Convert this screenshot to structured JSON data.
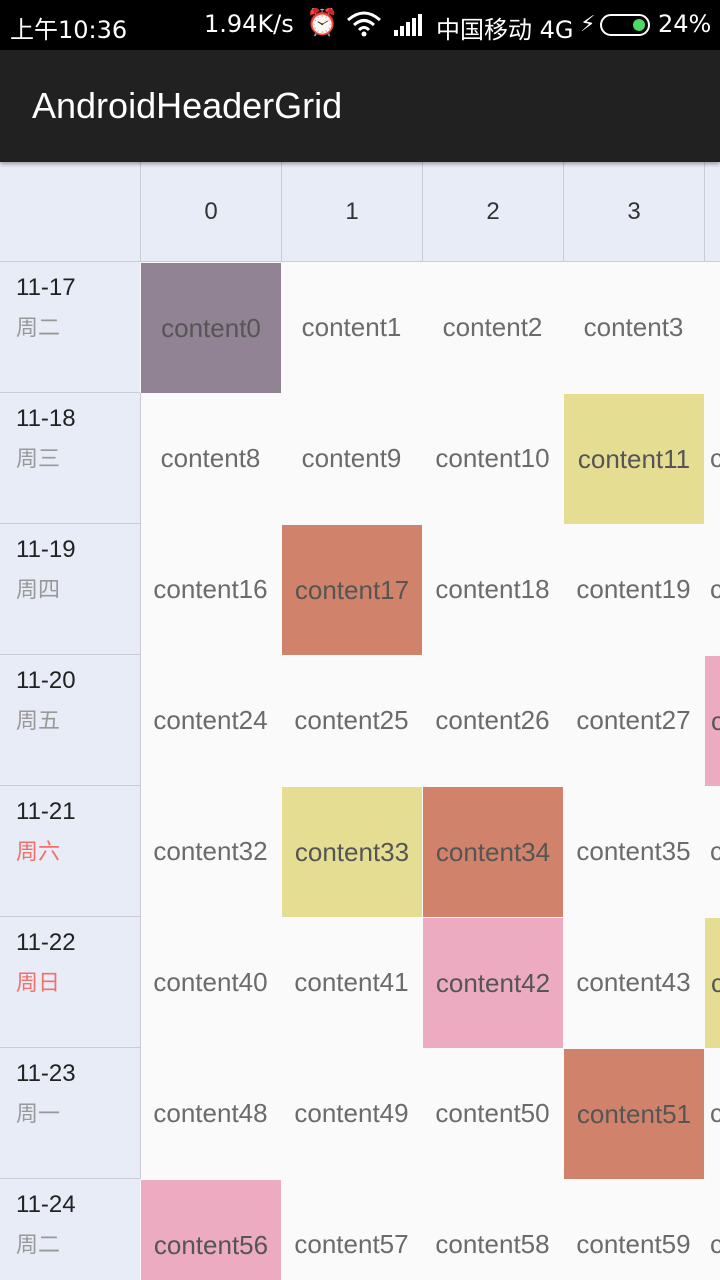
{
  "status_bar": {
    "time": "上午10:36",
    "net_speed": "1.94K/s",
    "alarm_icon": "alarm-clock-icon",
    "wifi_icon": "wifi-icon",
    "signal_icon": "signal-bars-icon",
    "carrier": "中国移动 4G",
    "charging_icon": "lightning-bolt-icon",
    "battery_icon": "battery-icon",
    "battery": "24%"
  },
  "app_bar": {
    "title": "AndroidHeaderGrid"
  },
  "grid": {
    "columns": [
      "0",
      "1",
      "2",
      "3",
      ""
    ],
    "rows": [
      {
        "date": "11-17",
        "weekday": "周二",
        "weekend": false,
        "cells": [
          {
            "text": "content0",
            "color": "#928394"
          },
          {
            "text": "content1",
            "color": null
          },
          {
            "text": "content2",
            "color": null
          },
          {
            "text": "content3",
            "color": null
          },
          {
            "text": "",
            "color": null
          }
        ]
      },
      {
        "date": "11-18",
        "weekday": "周三",
        "weekend": false,
        "cells": [
          {
            "text": "content8",
            "color": null
          },
          {
            "text": "content9",
            "color": null
          },
          {
            "text": "content10",
            "color": null
          },
          {
            "text": "content11",
            "color": "#e5dd92"
          },
          {
            "text": "c",
            "color": null
          }
        ]
      },
      {
        "date": "11-19",
        "weekday": "周四",
        "weekend": false,
        "cells": [
          {
            "text": "content16",
            "color": null
          },
          {
            "text": "content17",
            "color": "#d0826b"
          },
          {
            "text": "content18",
            "color": null
          },
          {
            "text": "content19",
            "color": null
          },
          {
            "text": "c",
            "color": null
          }
        ]
      },
      {
        "date": "11-20",
        "weekday": "周五",
        "weekend": false,
        "cells": [
          {
            "text": "content24",
            "color": null
          },
          {
            "text": "content25",
            "color": null
          },
          {
            "text": "content26",
            "color": null
          },
          {
            "text": "content27",
            "color": null
          },
          {
            "text": "c",
            "color": "#ecabc0"
          }
        ]
      },
      {
        "date": "11-21",
        "weekday": "周六",
        "weekend": true,
        "cells": [
          {
            "text": "content32",
            "color": null
          },
          {
            "text": "content33",
            "color": "#e5dd92"
          },
          {
            "text": "content34",
            "color": "#d0826b"
          },
          {
            "text": "content35",
            "color": null
          },
          {
            "text": "c",
            "color": null
          }
        ]
      },
      {
        "date": "11-22",
        "weekday": "周日",
        "weekend": true,
        "cells": [
          {
            "text": "content40",
            "color": null
          },
          {
            "text": "content41",
            "color": null
          },
          {
            "text": "content42",
            "color": "#ecabc0"
          },
          {
            "text": "content43",
            "color": null
          },
          {
            "text": "c",
            "color": "#e5dd92"
          }
        ]
      },
      {
        "date": "11-23",
        "weekday": "周一",
        "weekend": false,
        "cells": [
          {
            "text": "content48",
            "color": null
          },
          {
            "text": "content49",
            "color": null
          },
          {
            "text": "content50",
            "color": null
          },
          {
            "text": "content51",
            "color": "#d0826b"
          },
          {
            "text": "c",
            "color": null
          }
        ]
      },
      {
        "date": "11-24",
        "weekday": "周二",
        "weekend": false,
        "cells": [
          {
            "text": "content56",
            "color": "#ecabc0"
          },
          {
            "text": "content57",
            "color": null
          },
          {
            "text": "content58",
            "color": null
          },
          {
            "text": "content59",
            "color": null
          },
          {
            "text": "c",
            "color": null
          }
        ]
      }
    ]
  }
}
